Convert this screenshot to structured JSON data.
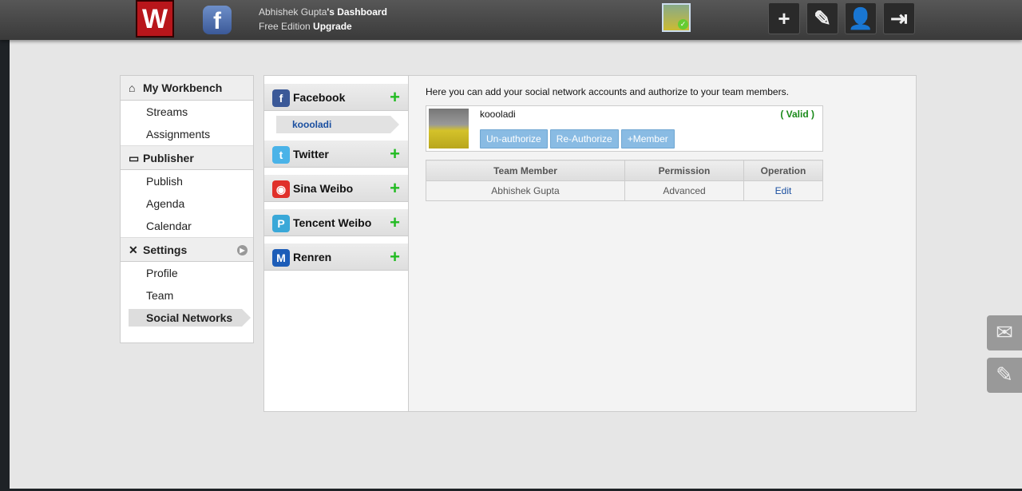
{
  "header": {
    "user": "Abhishek Gupta",
    "title_suffix": "'s Dashboard",
    "edition": "Free Edition",
    "upgrade": "Upgrade",
    "logo": "W",
    "fb_logo": "f"
  },
  "toolbar": [
    {
      "icon": "add-icon",
      "glyph": "+"
    },
    {
      "icon": "edit-icon",
      "glyph": "✎"
    },
    {
      "icon": "user-icon",
      "glyph": "👤"
    },
    {
      "icon": "logout-icon",
      "glyph": "⇥"
    }
  ],
  "sidebar": {
    "sections": [
      {
        "label": "My Workbench",
        "icon": "⌂",
        "items": [
          "Streams",
          "Assignments"
        ]
      },
      {
        "label": "Publisher",
        "icon": "▭",
        "items": [
          "Publish",
          "Agenda",
          "Calendar"
        ]
      },
      {
        "label": "Settings",
        "icon": "✕",
        "items": [
          "Profile",
          "Team",
          "Social Networks"
        ]
      }
    ],
    "active": "Social Networks"
  },
  "networks": [
    {
      "label": "Facebook",
      "glyph": "f",
      "color": "#3b5998",
      "accounts": [
        "koooladi"
      ]
    },
    {
      "label": "Twitter",
      "glyph": "t",
      "color": "#4ab3e8"
    },
    {
      "label": "Sina Weibo",
      "glyph": "◉",
      "color": "#e0302a"
    },
    {
      "label": "Tencent Weibo",
      "glyph": "P",
      "color": "#3aa8d8"
    },
    {
      "label": "Renren",
      "glyph": "M",
      "color": "#1d5db8"
    }
  ],
  "content": {
    "intro": "Here you can add your social network accounts and authorize to your team members.",
    "account": {
      "name": "koooladi",
      "status": "( Valid )",
      "buttons": [
        "Un-authorize",
        "Re-Authorize",
        "+Member"
      ]
    },
    "table": {
      "headers": [
        "Team Member",
        "Permission",
        "Operation"
      ],
      "rows": [
        [
          "Abhishek Gupta",
          "Advanced",
          "Edit"
        ]
      ]
    }
  },
  "side_buttons": [
    {
      "icon": "mail-icon",
      "glyph": "✉"
    },
    {
      "icon": "pencil-icon",
      "glyph": "✎"
    }
  ]
}
